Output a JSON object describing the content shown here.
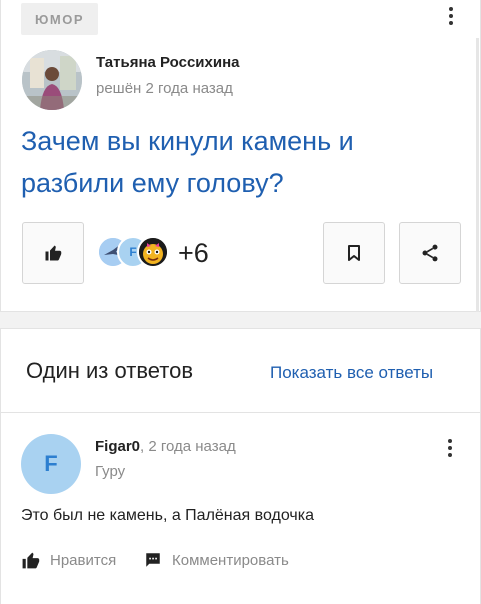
{
  "question_card": {
    "category_tag": "ЮМОР",
    "author_name": "Татьяна Россихина",
    "author_meta": "решён 2 года назад",
    "question_title": "Зачем вы кинули камень и разбили ему голову?",
    "likes_extra": "+6",
    "liker_avatar_letter": "F"
  },
  "answers_section": {
    "title": "Один из ответов",
    "show_all_link": "Показать все ответы"
  },
  "answer": {
    "avatar_letter": "F",
    "author_name": "Figar0",
    "time": ", 2 года назад",
    "rank": "Гуру",
    "text": "Это был не камень, а Палёная водочка",
    "like_label": "Нравится",
    "comment_label": "Комментировать"
  },
  "colors": {
    "link_blue": "#1f5fb0",
    "avatar_f_bg": "#a9d2f1",
    "muted_text": "#8a8a8a"
  },
  "icons": [
    "more-vertical-icon",
    "thumbs-up-icon",
    "bookmark-icon",
    "share-icon",
    "comment-icon"
  ]
}
